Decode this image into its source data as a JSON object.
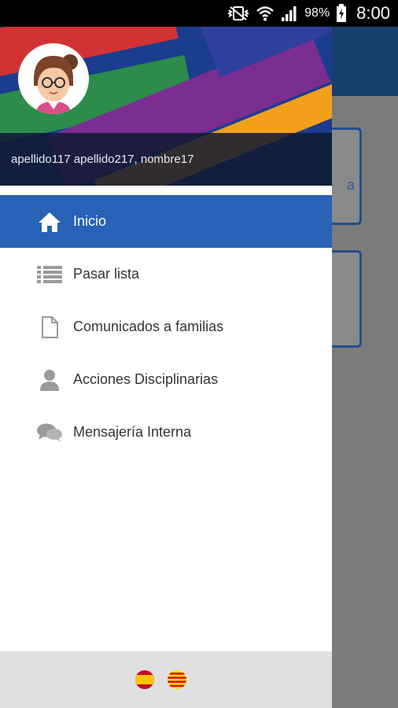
{
  "status_bar": {
    "battery_percent": "98%",
    "time": "8:00",
    "icons": [
      "vibrate-icon",
      "wifi-icon",
      "signal-icon",
      "battery-icon"
    ]
  },
  "drawer": {
    "user_name": "apellido117 apellido217, nombre17",
    "menu": [
      {
        "label": "Inicio",
        "icon": "home-icon",
        "active": true
      },
      {
        "label": "Pasar lista",
        "icon": "list-icon",
        "active": false
      },
      {
        "label": "Comunicados a familias",
        "icon": "document-icon",
        "active": false
      },
      {
        "label": "Acciones Disciplinarias",
        "icon": "person-icon",
        "active": false
      },
      {
        "label": "Mensajería Interna",
        "icon": "chat-icon",
        "active": false
      }
    ],
    "footer_flags": [
      "flag-spain-icon",
      "flag-catalonia-icon"
    ]
  },
  "background_app": {
    "peek_text": "a"
  },
  "colors": {
    "accent": "#2762b6",
    "toolbar": "#173e6c",
    "scrim": "#7c7c7c"
  }
}
